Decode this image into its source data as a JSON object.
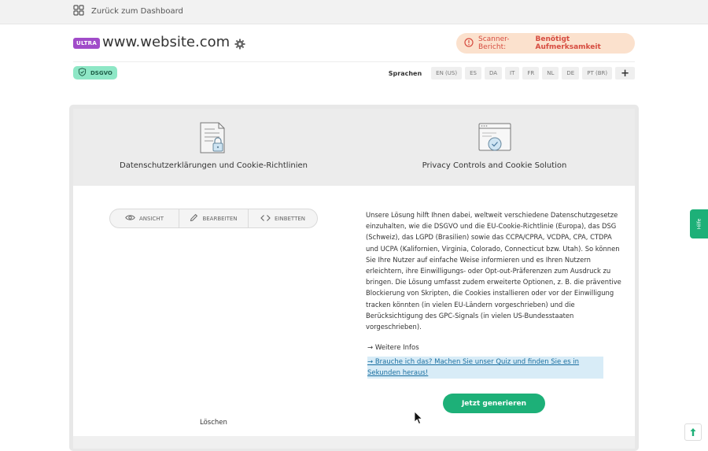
{
  "topbar": {
    "back_label": "Zurück zum Dashboard",
    "icon": "grid-icon"
  },
  "header": {
    "plan_badge": "ULTRA",
    "site": "www.website.com",
    "scanner_prefix": "Scanner-Bericht:",
    "scanner_status": "Benötigt Aufmerksamkeit"
  },
  "compliance_badge": "DSGVO",
  "languages": {
    "label": "Sprachen",
    "items": [
      "EN (US)",
      "ES",
      "DA",
      "IT",
      "FR",
      "NL",
      "DE",
      "PT (BR)"
    ],
    "add": "+"
  },
  "tabs": [
    {
      "label": "Datenschutzerklärungen und Cookie-Richtlinien",
      "icon": "document-lock-icon"
    },
    {
      "label": "Privacy Controls and Cookie Solution",
      "icon": "browser-shield-icon"
    }
  ],
  "modes": [
    {
      "label": "ANSICHT",
      "icon": "eye-icon"
    },
    {
      "label": "BEARBEITEN",
      "icon": "pencil-icon"
    },
    {
      "label": "EINBETTEN",
      "icon": "code-icon"
    }
  ],
  "description": "Unsere Lösung hilft Ihnen dabei, weltweit verschiedene Datenschutzgesetze einzuhalten, wie die DSGVO und die EU-Cookie-Richtlinie (Europa), das DSG (Schweiz), das LGPD (Brasilien) sowie das CCPA/CPRA, VCDPA, CPA, CTDPA und UCPA (Kalifornien, Virginia, Colorado, Connecticut bzw. Utah). So können Sie Ihre Nutzer auf einfache Weise informieren und es Ihren Nutzern erleichtern, ihre Einwilligungs- oder Opt-out-Präferenzen zum Ausdruck zu bringen. Die Lösung umfasst zudem erweiterte Optionen, z. B. die präventive Blockierung von Skripten, die Cookies installieren oder vor der Einwilligung tracken könnten (in vielen EU-Ländern vorgeschrieben) und die Berücksichtigung des GPC-Signals (in vielen US-Bundesstaaten vorgeschrieben).",
  "links": {
    "more": "→ Weitere Infos",
    "quiz": "→ Brauche ich das? Machen Sie unser Quiz und finden Sie es in Sekunden heraus!"
  },
  "actions": {
    "generate": "Jetzt generieren",
    "delete": "Löschen"
  },
  "help": "Hilfe",
  "colors": {
    "accent": "#1db078",
    "warning": "#d64b3f",
    "ultra": "#a14cc9",
    "dsgvo": "#8ee7c6"
  }
}
